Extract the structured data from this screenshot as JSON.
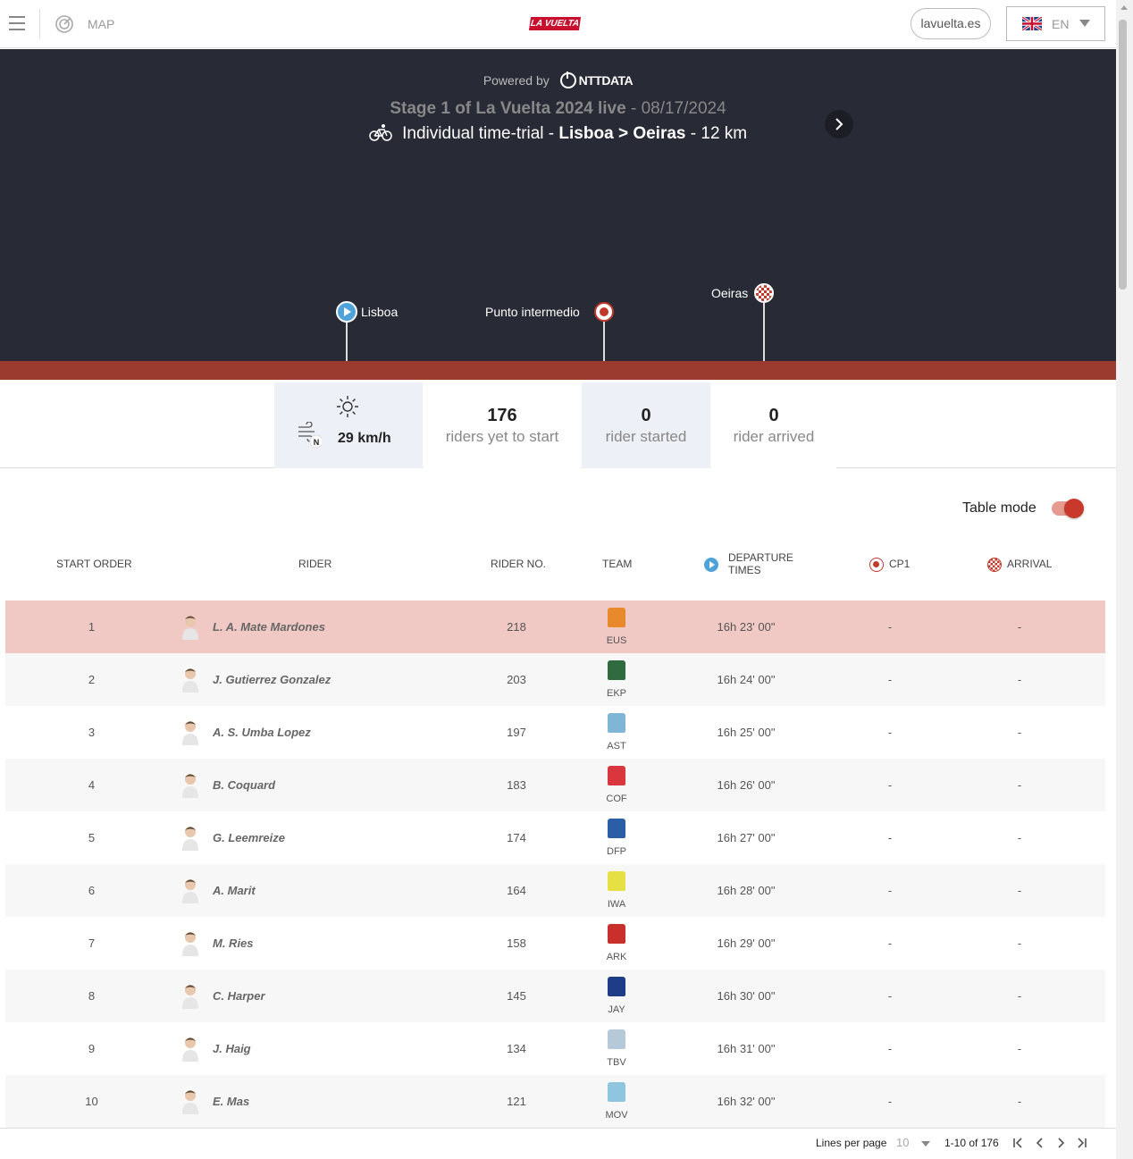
{
  "header": {
    "map_label": "MAP",
    "logo_text": "LA VUELTA",
    "site_link": "lavuelta.es",
    "language": "EN"
  },
  "hero": {
    "powered_by": "Powered by",
    "sponsor": "NTTDATA",
    "stage_title": "Stage 1 of La Vuelta 2024 live",
    "stage_date": "- 08/17/2024",
    "stage_type": "Individual time-trial -",
    "start_city": "Lisboa",
    "route_sep": ">",
    "end_city": "Oeiras",
    "distance": "- 12 km",
    "markers": {
      "start": "Lisboa",
      "intermediate": "Punto intermedio",
      "finish": "Oeiras"
    }
  },
  "stats": {
    "wind_speed": "29 km/h",
    "wind_direction": "N",
    "yet_to_start_num": "176",
    "yet_to_start_label": "riders yet to start",
    "started_num": "0",
    "started_label": "rider started",
    "arrived_num": "0",
    "arrived_label": "rider arrived"
  },
  "table_mode": {
    "label": "Table mode",
    "enabled": true
  },
  "table": {
    "headers": {
      "start_order": "START ORDER",
      "rider": "RIDER",
      "rider_no": "RIDER NO.",
      "team": "TEAM",
      "departure_1": "DEPARTURE",
      "departure_2": "TIMES",
      "cp1": "CP1",
      "arrival": "ARRIVAL"
    },
    "rows": [
      {
        "order": "1",
        "name": "L. A. Mate Mardones",
        "no": "218",
        "team": "EUS",
        "jersey": "#e8892b",
        "departure": "16h 23' 00\"",
        "cp1": "-",
        "arrival": "-"
      },
      {
        "order": "2",
        "name": "J. Gutierrez Gonzalez",
        "no": "203",
        "team": "EKP",
        "jersey": "#2f6b3f",
        "departure": "16h 24' 00\"",
        "cp1": "-",
        "arrival": "-"
      },
      {
        "order": "3",
        "name": "A. S. Umba Lopez",
        "no": "197",
        "team": "AST",
        "jersey": "#7fb6d6",
        "departure": "16h 25' 00\"",
        "cp1": "-",
        "arrival": "-"
      },
      {
        "order": "4",
        "name": "B. Coquard",
        "no": "183",
        "team": "COF",
        "jersey": "#d9363e",
        "departure": "16h 26' 00\"",
        "cp1": "-",
        "arrival": "-"
      },
      {
        "order": "5",
        "name": "G. Leemreize",
        "no": "174",
        "team": "DFP",
        "jersey": "#2c5ea8",
        "departure": "16h 27' 00\"",
        "cp1": "-",
        "arrival": "-"
      },
      {
        "order": "6",
        "name": "A. Marit",
        "no": "164",
        "team": "IWA",
        "jersey": "#e6e045",
        "departure": "16h 28' 00\"",
        "cp1": "-",
        "arrival": "-"
      },
      {
        "order": "7",
        "name": "M. Ries",
        "no": "158",
        "team": "ARK",
        "jersey": "#c9302c",
        "departure": "16h 29' 00\"",
        "cp1": "-",
        "arrival": "-"
      },
      {
        "order": "8",
        "name": "C. Harper",
        "no": "145",
        "team": "JAY",
        "jersey": "#1f3c88",
        "departure": "16h 30' 00\"",
        "cp1": "-",
        "arrival": "-"
      },
      {
        "order": "9",
        "name": "J. Haig",
        "no": "134",
        "team": "TBV",
        "jersey": "#b5c9d9",
        "departure": "16h 31' 00\"",
        "cp1": "-",
        "arrival": "-"
      },
      {
        "order": "10",
        "name": "E. Mas",
        "no": "121",
        "team": "MOV",
        "jersey": "#8fc5df",
        "departure": "16h 32' 00\"",
        "cp1": "-",
        "arrival": "-"
      }
    ]
  },
  "pagination": {
    "lines_label": "Lines per page",
    "page_size": "10",
    "range": "1-10 of 176"
  },
  "colors": {
    "brand": "#c8102e",
    "hero_bg": "#282a36",
    "highlight_row": "#f0c9c4",
    "toggle": "#c8392b"
  }
}
